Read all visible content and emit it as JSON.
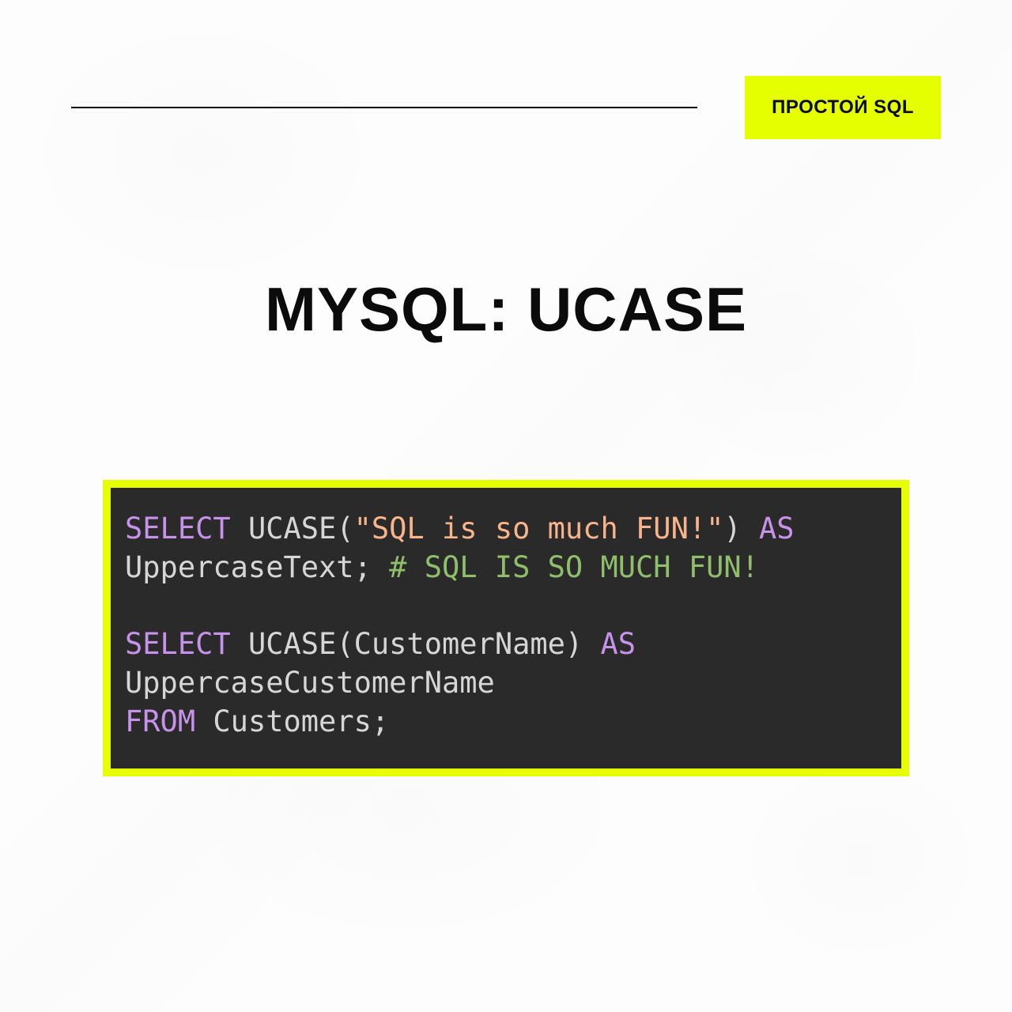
{
  "colors": {
    "accent": "#e6ff00",
    "code_bg": "#2a2a2a",
    "code_fg": "#d6d6d6",
    "keyword": "#c792ea",
    "string": "#f8b48b",
    "comment": "#8fbf6b",
    "text": "#0b0b0b"
  },
  "header": {
    "badge_label": "ПРОСТОЙ SQL"
  },
  "title": "MYSQL: UCASE",
  "code": {
    "line1": {
      "kw_select": "SELECT",
      "fn_ucase": "UCASE",
      "paren_open": "(",
      "string_literal": "\"SQL is so much FUN!\"",
      "paren_close": ")",
      "kw_as": "AS"
    },
    "line2": {
      "alias": "UppercaseText;",
      "comment": "# SQL IS SO MUCH FUN!"
    },
    "line4": {
      "kw_select": "SELECT",
      "fn_ucase": "UCASE",
      "paren_open": "(",
      "arg": "CustomerName",
      "paren_close": ")",
      "kw_as": "AS"
    },
    "line5": {
      "alias": "UppercaseCustomerName"
    },
    "line6": {
      "kw_from": "FROM",
      "table": "Customers;"
    }
  }
}
